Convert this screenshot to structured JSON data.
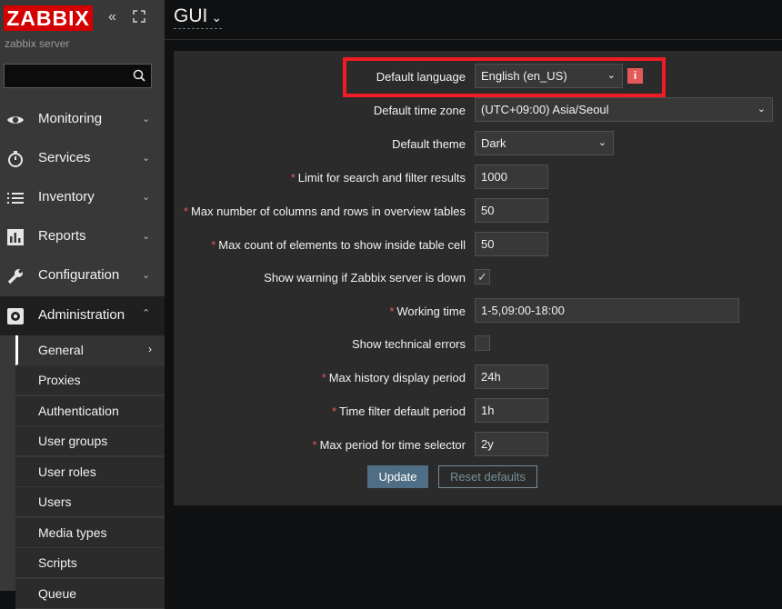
{
  "sidebar": {
    "logo": "ZABBIX",
    "server_name": "zabbix server",
    "search_placeholder": "",
    "menu": [
      {
        "label": "Monitoring",
        "icon": "eye-icon"
      },
      {
        "label": "Services",
        "icon": "stopwatch-icon"
      },
      {
        "label": "Inventory",
        "icon": "list-icon"
      },
      {
        "label": "Reports",
        "icon": "bar-chart-icon"
      },
      {
        "label": "Configuration",
        "icon": "wrench-icon"
      },
      {
        "label": "Administration",
        "icon": "gear-icon"
      }
    ],
    "admin_submenu": [
      "General",
      "Proxies",
      "Authentication",
      "User groups",
      "User roles",
      "Users",
      "Media types",
      "Scripts",
      "Queue"
    ]
  },
  "header": {
    "title": "GUI"
  },
  "form": {
    "default_language": {
      "label": "Default language",
      "value": "English (en_US)"
    },
    "default_time_zone": {
      "label": "Default time zone",
      "value": "(UTC+09:00) Asia/Seoul"
    },
    "default_theme": {
      "label": "Default theme",
      "value": "Dark"
    },
    "search_limit": {
      "label": "Limit for search and filter results",
      "value": "1000"
    },
    "max_overview": {
      "label": "Max number of columns and rows in overview tables",
      "value": "50"
    },
    "max_table_cell": {
      "label": "Max count of elements to show inside table cell",
      "value": "50"
    },
    "server_check": {
      "label": "Show warning if Zabbix server is down",
      "checked": true
    },
    "working_time": {
      "label": "Working time",
      "value": "1-5,09:00-18:00"
    },
    "show_tech_errors": {
      "label": "Show technical errors",
      "checked": false
    },
    "history_period": {
      "label": "Max history display period",
      "value": "24h"
    },
    "time_filter_period": {
      "label": "Time filter default period",
      "value": "1h"
    },
    "max_period": {
      "label": "Max period for time selector",
      "value": "2y"
    },
    "update_label": "Update",
    "reset_label": "Reset defaults"
  },
  "colors": {
    "accent_red": "#d40000",
    "highlight_border": "#ee1c25",
    "required": "#e45959",
    "primary_button": "#4f6e85"
  }
}
